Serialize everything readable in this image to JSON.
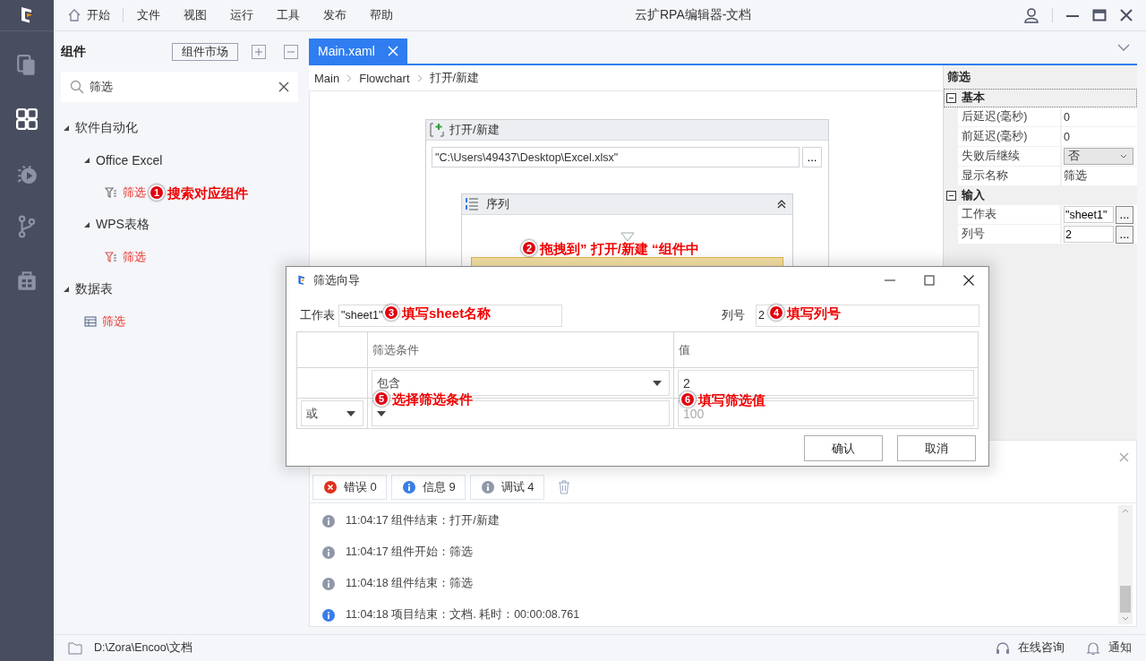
{
  "app": {
    "title": "云扩RPA编辑器-文档"
  },
  "rail": [
    {
      "kind": "documents",
      "selected": false
    },
    {
      "kind": "grid",
      "selected": true
    },
    {
      "kind": "debug",
      "selected": false
    },
    {
      "kind": "branch",
      "selected": false
    },
    {
      "kind": "toolbox",
      "selected": false
    }
  ],
  "menu": [
    {
      "label": "开始",
      "kind": "home"
    },
    {
      "label": "文件",
      "kind": "plain"
    },
    {
      "label": "视图",
      "kind": "plain"
    },
    {
      "label": "运行",
      "kind": "plain"
    },
    {
      "label": "工具",
      "kind": "plain"
    },
    {
      "label": "发布",
      "kind": "plain"
    },
    {
      "label": "帮助",
      "kind": "plain"
    }
  ],
  "sidebar": {
    "title": "组件",
    "market_button": "组件市场",
    "search": {
      "value": "筛选"
    },
    "tree": [
      {
        "label": "软件自动化",
        "expanded": true,
        "children": [
          {
            "label": "Office Excel",
            "expanded": true,
            "children": [
              {
                "label": "筛选",
                "kind": "filter",
                "matched": true
              }
            ]
          },
          {
            "label": "WPS表格",
            "expanded": true,
            "children": [
              {
                "label": "筛选",
                "kind": "filteralt",
                "matched": true
              }
            ]
          }
        ]
      },
      {
        "label": "数据表",
        "expanded": true,
        "children": [
          {
            "label": "筛选",
            "kind": "table",
            "matched": true
          }
        ]
      }
    ]
  },
  "editor": {
    "tabs": [
      {
        "label": "Main.xaml",
        "selected": true
      }
    ],
    "breadcrumb": [
      "Main",
      "Flowchart",
      "打开/新建"
    ],
    "activity": {
      "title": "打开/新建",
      "path": "\"C:\\Users\\49437\\Desktop\\Excel.xlsx\"",
      "browse_button": "...",
      "sequence": {
        "title": "序列",
        "expanded": true
      }
    }
  },
  "properties": {
    "title": "筛选",
    "categories": [
      {
        "name": "基本",
        "expanded": true,
        "rows": [
          {
            "label": "后延迟(毫秒)",
            "value": "0",
            "kind": "text"
          },
          {
            "label": "前延迟(毫秒)",
            "value": "0",
            "kind": "text"
          },
          {
            "label": "失败后继续",
            "value": "否",
            "kind": "dropdown"
          },
          {
            "label": "显示名称",
            "value": "筛选",
            "kind": "text"
          }
        ]
      },
      {
        "name": "输入",
        "expanded": true,
        "rows": [
          {
            "label": "工作表",
            "value": "\"sheet1\"",
            "kind": "input",
            "button": "..."
          },
          {
            "label": "列号",
            "value": "2",
            "kind": "input",
            "button": "..."
          }
        ]
      }
    ]
  },
  "output": {
    "filters": [
      {
        "label": "错误",
        "count": "0",
        "kind": "error"
      },
      {
        "label": "信息",
        "count": "9",
        "kind": "info"
      },
      {
        "label": "调试",
        "count": "4",
        "kind": "debug"
      }
    ],
    "logs": [
      {
        "kind": "debug",
        "text": "11:04:17 组件结束：打开/新建"
      },
      {
        "kind": "debug",
        "text": "11:04:17 组件开始：筛选"
      },
      {
        "kind": "debug",
        "text": "11:04:18 组件结束：筛选"
      },
      {
        "kind": "info",
        "text": "11:04:18 项目结束：文档. 耗时：00:00:08.761"
      }
    ]
  },
  "dialog": {
    "title": "筛选向导",
    "sheet_label": "工作表",
    "sheet_value": "\"sheet1\"",
    "column_label": "列号",
    "column_value": "2",
    "columns": [
      "筛选条件",
      "值"
    ],
    "rows": [
      {
        "condition": "包含",
        "value": "2"
      },
      {
        "connector": "或",
        "value_placeholder": "100"
      }
    ],
    "buttons": [
      "确认",
      "取消"
    ]
  },
  "annotations": [
    {
      "number": "1",
      "text": "搜索对应组件"
    },
    {
      "number": "2",
      "text": "拖拽到” 打开/新建 “组件中"
    },
    {
      "number": "3",
      "text": "填写sheet名称"
    },
    {
      "number": "4",
      "text": "填写列号"
    },
    {
      "number": "5",
      "text": "选择筛选条件"
    },
    {
      "number": "6",
      "text": "填写筛选值"
    }
  ],
  "status": {
    "path": "D:\\Zora\\Encoo\\文档",
    "links": [
      {
        "label": "在线咨询",
        "kind": "headset"
      },
      {
        "label": "通知",
        "kind": "bell"
      }
    ]
  }
}
